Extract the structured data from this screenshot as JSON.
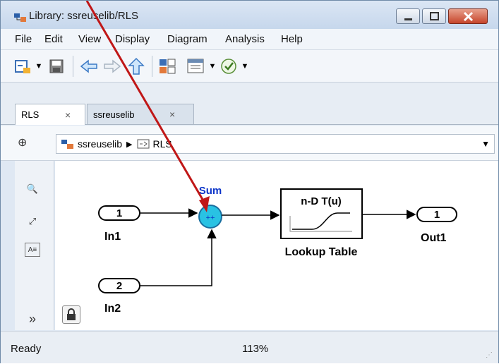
{
  "window": {
    "title": "Library: ssreuselib/RLS"
  },
  "menu": {
    "items": [
      "File",
      "Edit",
      "View",
      "Display",
      "Diagram",
      "Analysis",
      "Help"
    ]
  },
  "tabs": [
    {
      "label": "RLS",
      "close": "×"
    },
    {
      "label": "ssreuselib",
      "close": "×"
    }
  ],
  "breadcrumb": {
    "root": "ssreuselib",
    "separator": "▶",
    "current": "RLS"
  },
  "diagram": {
    "blocks": {
      "in1": {
        "port": "1",
        "name": "In1"
      },
      "in2": {
        "port": "2",
        "name": "In2"
      },
      "sum": {
        "name": "Sum",
        "signs": "++"
      },
      "lookup": {
        "title": "n-D T(u)",
        "name": "Lookup Table"
      },
      "out1": {
        "port": "1",
        "name": "Out1"
      }
    }
  },
  "status": {
    "left": "Ready",
    "zoom": "113%"
  },
  "colors": {
    "arrow": "#c01717",
    "sum_fill": "#29c2e3",
    "sum_label": "#0b34c9",
    "close_button": "#c6452b"
  },
  "icons": [
    "library-icon",
    "new-model-icon",
    "save-icon",
    "back-icon",
    "forward-icon",
    "up-icon",
    "library-browser-icon",
    "model-config-icon",
    "check-icon",
    "zoom-in-icon",
    "fit-view-icon",
    "annotation-icon",
    "expand-icon",
    "lock-icon"
  ]
}
